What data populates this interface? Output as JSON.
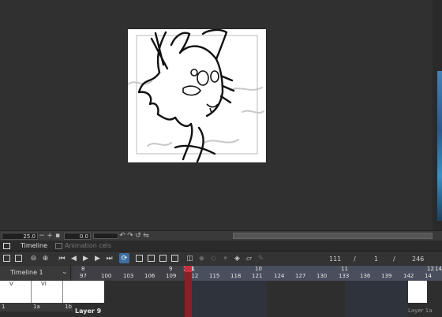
{
  "status": {
    "zoom": "25.0",
    "angle": "0.0"
  },
  "tabs": [
    {
      "label": "Timeline"
    },
    {
      "label": "Animation cels"
    }
  ],
  "toolbar": {
    "current_frame": "111",
    "sep1": "/",
    "page": "1",
    "sep2": "/",
    "end_frame": "246"
  },
  "timeline": {
    "name": "Timeline 1",
    "ruler_top": [
      {
        "label": "8",
        "at": 0
      },
      {
        "label": "9",
        "at": 1
      },
      {
        "label": "111",
        "at": 2
      },
      {
        "label": "10",
        "at": 3
      },
      {
        "label": "11",
        "at": 4
      },
      {
        "label": "12",
        "at": 5
      },
      {
        "label": "14",
        "at": 6
      }
    ],
    "ruler_frames": [
      "97",
      "100",
      "103",
      "106",
      "109",
      "112",
      "115",
      "118",
      "121",
      "124",
      "127",
      "130",
      "133",
      "136",
      "139",
      "142",
      "14"
    ],
    "cels": [
      {
        "label": "1",
        "mark": "V"
      },
      {
        "label": "1a",
        "mark": "VI"
      },
      {
        "label": "1b",
        "mark": "V"
      }
    ],
    "layer_name": "Layer 9",
    "end_layer_label": "Layer 1a"
  }
}
